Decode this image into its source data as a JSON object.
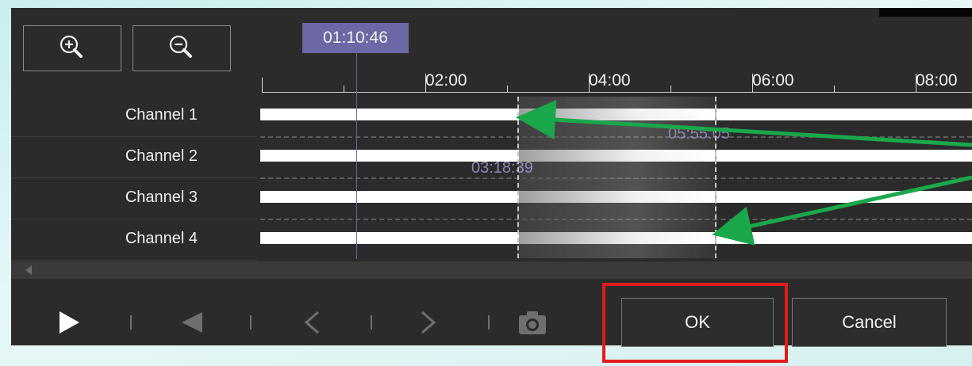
{
  "cursor": {
    "time": "01:10:46"
  },
  "ruler": {
    "ticks": [
      "02:00",
      "04:00",
      "06:00",
      "08:00"
    ]
  },
  "channels": [
    {
      "label": "Channel 1"
    },
    {
      "label": "Channel 2"
    },
    {
      "label": "Channel 3"
    },
    {
      "label": "Channel 4"
    }
  ],
  "selection": {
    "start": "03:18:39",
    "end": "05:55:05"
  },
  "zoom": {
    "in_icon": "zoom-in-icon",
    "out_icon": "zoom-out-icon"
  },
  "playback": {
    "icons": [
      "play-icon",
      "rewind-icon",
      "previous-frame-icon",
      "next-frame-icon",
      "camera-icon"
    ]
  },
  "buttons": {
    "ok": "OK",
    "cancel": "Cancel"
  },
  "colors": {
    "panel": "#2b2b2b",
    "cursor": "#6c68a5",
    "highlight": "#e41b1b",
    "annotation": "#1aa84a"
  }
}
